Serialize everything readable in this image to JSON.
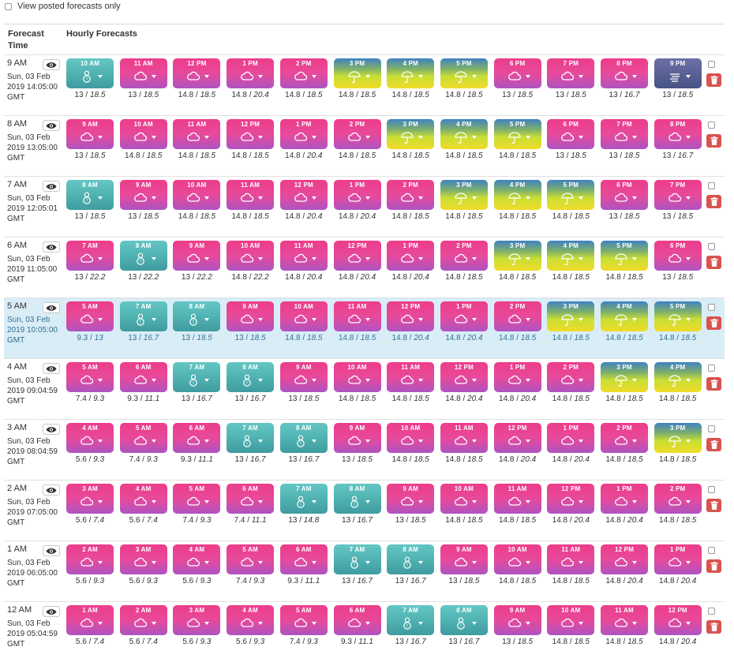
{
  "filter": {
    "label": "View posted forecasts only"
  },
  "columns": {
    "forecast_time": "Forecast\nTime",
    "hourly": "Hourly Forecasts"
  },
  "icons": {
    "rainy": "cloud-icon",
    "snow": "snowman-icon",
    "umbrella": "umbrella-icon",
    "fog": "fog-icon",
    "view": "eye-icon",
    "delete": "trash-icon"
  },
  "colors": {
    "rainy": "#e8499a",
    "snow": "#4fb0b0",
    "umbrella": "#c9de34",
    "fog": "#465384",
    "delete": "#d9534f",
    "highlight": "#d9edf7"
  },
  "rows": [
    {
      "time": "9 AM",
      "date": "Sun, 03 Feb\n2019 14:05:00\nGMT",
      "hours": [
        {
          "h": "10 AM",
          "c": "snow",
          "t": "13",
          "p": "18.5"
        },
        {
          "h": "11 AM",
          "c": "rainy",
          "t": "13",
          "p": "18.5"
        },
        {
          "h": "12 PM",
          "c": "rainy",
          "t": "14.8",
          "p": "18.5"
        },
        {
          "h": "1 PM",
          "c": "rainy",
          "t": "14.8",
          "p": "20.4"
        },
        {
          "h": "2 PM",
          "c": "rainy",
          "t": "14.8",
          "p": "18.5"
        },
        {
          "h": "3 PM",
          "c": "umbrella",
          "t": "14.8",
          "p": "18.5"
        },
        {
          "h": "4 PM",
          "c": "umbrella",
          "t": "14.8",
          "p": "18.5"
        },
        {
          "h": "5 PM",
          "c": "umbrella",
          "t": "14.8",
          "p": "18.5"
        },
        {
          "h": "6 PM",
          "c": "rainy",
          "t": "13",
          "p": "18.5"
        },
        {
          "h": "7 PM",
          "c": "rainy",
          "t": "13",
          "p": "18.5"
        },
        {
          "h": "8 PM",
          "c": "rainy",
          "t": "13",
          "p": "16.7"
        },
        {
          "h": "9 PM",
          "c": "fog",
          "t": "13",
          "p": "18.5"
        }
      ]
    },
    {
      "time": "8 AM",
      "date": "Sun, 03 Feb\n2019 13:05:00\nGMT",
      "hours": [
        {
          "h": "9 AM",
          "c": "rainy",
          "t": "13",
          "p": "18.5"
        },
        {
          "h": "10 AM",
          "c": "rainy",
          "t": "14.8",
          "p": "18.5"
        },
        {
          "h": "11 AM",
          "c": "rainy",
          "t": "14.8",
          "p": "18.5"
        },
        {
          "h": "12 PM",
          "c": "rainy",
          "t": "14.8",
          "p": "18.5"
        },
        {
          "h": "1 PM",
          "c": "rainy",
          "t": "14.8",
          "p": "20.4"
        },
        {
          "h": "2 PM",
          "c": "rainy",
          "t": "14.8",
          "p": "18.5"
        },
        {
          "h": "3 PM",
          "c": "umbrella",
          "t": "14.8",
          "p": "18.5"
        },
        {
          "h": "4 PM",
          "c": "umbrella",
          "t": "14.8",
          "p": "18.5"
        },
        {
          "h": "5 PM",
          "c": "umbrella",
          "t": "14.8",
          "p": "18.5"
        },
        {
          "h": "6 PM",
          "c": "rainy",
          "t": "13",
          "p": "18.5"
        },
        {
          "h": "7 PM",
          "c": "rainy",
          "t": "13",
          "p": "18.5"
        },
        {
          "h": "8 PM",
          "c": "rainy",
          "t": "13",
          "p": "16.7"
        }
      ]
    },
    {
      "time": "7 AM",
      "date": "Sun, 03 Feb\n2019 12:05:01\nGMT",
      "hours": [
        {
          "h": "8 AM",
          "c": "snow",
          "t": "13",
          "p": "18.5"
        },
        {
          "h": "9 AM",
          "c": "rainy",
          "t": "13",
          "p": "18.5"
        },
        {
          "h": "10 AM",
          "c": "rainy",
          "t": "14.8",
          "p": "18.5"
        },
        {
          "h": "11 AM",
          "c": "rainy",
          "t": "14.8",
          "p": "18.5"
        },
        {
          "h": "12 PM",
          "c": "rainy",
          "t": "14.8",
          "p": "20.4"
        },
        {
          "h": "1 PM",
          "c": "rainy",
          "t": "14.8",
          "p": "20.4"
        },
        {
          "h": "2 PM",
          "c": "rainy",
          "t": "14.8",
          "p": "18.5"
        },
        {
          "h": "3 PM",
          "c": "umbrella",
          "t": "14.8",
          "p": "18.5"
        },
        {
          "h": "4 PM",
          "c": "umbrella",
          "t": "14.8",
          "p": "18.5"
        },
        {
          "h": "5 PM",
          "c": "umbrella",
          "t": "14.8",
          "p": "18.5"
        },
        {
          "h": "6 PM",
          "c": "rainy",
          "t": "13",
          "p": "18.5"
        },
        {
          "h": "7 PM",
          "c": "rainy",
          "t": "13",
          "p": "18.5"
        }
      ]
    },
    {
      "time": "6 AM",
      "date": "Sun, 03 Feb\n2019 11:05:00\nGMT",
      "hours": [
        {
          "h": "7 AM",
          "c": "rainy",
          "t": "13",
          "p": "22.2"
        },
        {
          "h": "8 AM",
          "c": "snow",
          "t": "13",
          "p": "22.2"
        },
        {
          "h": "9 AM",
          "c": "rainy",
          "t": "13",
          "p": "22.2"
        },
        {
          "h": "10 AM",
          "c": "rainy",
          "t": "14.8",
          "p": "22.2"
        },
        {
          "h": "11 AM",
          "c": "rainy",
          "t": "14.8",
          "p": "20.4"
        },
        {
          "h": "12 PM",
          "c": "rainy",
          "t": "14.8",
          "p": "20.4"
        },
        {
          "h": "1 PM",
          "c": "rainy",
          "t": "14.8",
          "p": "20.4"
        },
        {
          "h": "2 PM",
          "c": "rainy",
          "t": "14.8",
          "p": "18.5"
        },
        {
          "h": "3 PM",
          "c": "umbrella",
          "t": "14.8",
          "p": "18.5"
        },
        {
          "h": "4 PM",
          "c": "umbrella",
          "t": "14.8",
          "p": "18.5"
        },
        {
          "h": "5 PM",
          "c": "umbrella",
          "t": "14.8",
          "p": "18.5"
        },
        {
          "h": "6 PM",
          "c": "rainy",
          "t": "13",
          "p": "18.5"
        }
      ]
    },
    {
      "time": "5 AM",
      "highlighted": true,
      "date": "Sun, 03 Feb\n2019 10:05:00\nGMT",
      "hours": [
        {
          "h": "5 AM",
          "c": "rainy",
          "t": "9.3",
          "p": "13"
        },
        {
          "h": "7 AM",
          "c": "snow",
          "t": "13",
          "p": "16.7"
        },
        {
          "h": "8 AM",
          "c": "snow",
          "t": "13",
          "p": "18.5"
        },
        {
          "h": "9 AM",
          "c": "rainy",
          "t": "13",
          "p": "18.5"
        },
        {
          "h": "10 AM",
          "c": "rainy",
          "t": "14.8",
          "p": "18.5"
        },
        {
          "h": "11 AM",
          "c": "rainy",
          "t": "14.8",
          "p": "18.5"
        },
        {
          "h": "12 PM",
          "c": "rainy",
          "t": "14.8",
          "p": "20.4"
        },
        {
          "h": "1 PM",
          "c": "rainy",
          "t": "14.8",
          "p": "20.4"
        },
        {
          "h": "2 PM",
          "c": "rainy",
          "t": "14.8",
          "p": "18.5"
        },
        {
          "h": "3 PM",
          "c": "umbrella",
          "t": "14.8",
          "p": "18.5"
        },
        {
          "h": "4 PM",
          "c": "umbrella",
          "t": "14.8",
          "p": "18.5"
        },
        {
          "h": "5 PM",
          "c": "umbrella",
          "t": "14.8",
          "p": "18.5"
        }
      ]
    },
    {
      "time": "4 AM",
      "date": "Sun, 03 Feb\n2019 09:04:59\nGMT",
      "hours": [
        {
          "h": "5 AM",
          "c": "rainy",
          "t": "7.4",
          "p": "9.3"
        },
        {
          "h": "6 AM",
          "c": "rainy",
          "t": "9.3",
          "p": "11.1"
        },
        {
          "h": "7 AM",
          "c": "snow",
          "t": "13",
          "p": "16.7"
        },
        {
          "h": "8 AM",
          "c": "snow",
          "t": "13",
          "p": "16.7"
        },
        {
          "h": "9 AM",
          "c": "rainy",
          "t": "13",
          "p": "18.5"
        },
        {
          "h": "10 AM",
          "c": "rainy",
          "t": "14.8",
          "p": "18.5"
        },
        {
          "h": "11 AM",
          "c": "rainy",
          "t": "14.8",
          "p": "18.5"
        },
        {
          "h": "12 PM",
          "c": "rainy",
          "t": "14.8",
          "p": "20.4"
        },
        {
          "h": "1 PM",
          "c": "rainy",
          "t": "14.8",
          "p": "20.4"
        },
        {
          "h": "2 PM",
          "c": "rainy",
          "t": "14.8",
          "p": "18.5"
        },
        {
          "h": "3 PM",
          "c": "umbrella",
          "t": "14.8",
          "p": "18.5"
        },
        {
          "h": "4 PM",
          "c": "umbrella",
          "t": "14.8",
          "p": "18.5"
        }
      ]
    },
    {
      "time": "3 AM",
      "date": "Sun, 03 Feb\n2019 08:04:59\nGMT",
      "hours": [
        {
          "h": "4 AM",
          "c": "rainy",
          "t": "5.6",
          "p": "9.3"
        },
        {
          "h": "5 AM",
          "c": "rainy",
          "t": "7.4",
          "p": "9.3"
        },
        {
          "h": "6 AM",
          "c": "rainy",
          "t": "9.3",
          "p": "11.1"
        },
        {
          "h": "7 AM",
          "c": "snow",
          "t": "13",
          "p": "16.7"
        },
        {
          "h": "8 AM",
          "c": "snow",
          "t": "13",
          "p": "16.7"
        },
        {
          "h": "9 AM",
          "c": "rainy",
          "t": "13",
          "p": "18.5"
        },
        {
          "h": "10 AM",
          "c": "rainy",
          "t": "14.8",
          "p": "18.5"
        },
        {
          "h": "11 AM",
          "c": "rainy",
          "t": "14.8",
          "p": "18.5"
        },
        {
          "h": "12 PM",
          "c": "rainy",
          "t": "14.8",
          "p": "20.4"
        },
        {
          "h": "1 PM",
          "c": "rainy",
          "t": "14.8",
          "p": "20.4"
        },
        {
          "h": "2 PM",
          "c": "rainy",
          "t": "14.8",
          "p": "18.5"
        },
        {
          "h": "3 PM",
          "c": "umbrella",
          "t": "14.8",
          "p": "18.5"
        }
      ]
    },
    {
      "time": "2 AM",
      "date": "Sun, 03 Feb\n2019 07:05:00\nGMT",
      "hours": [
        {
          "h": "3 AM",
          "c": "rainy",
          "t": "5.6",
          "p": "7.4"
        },
        {
          "h": "4 AM",
          "c": "rainy",
          "t": "5.6",
          "p": "7.4"
        },
        {
          "h": "5 AM",
          "c": "rainy",
          "t": "7.4",
          "p": "9.3"
        },
        {
          "h": "6 AM",
          "c": "rainy",
          "t": "7.4",
          "p": "11.1"
        },
        {
          "h": "7 AM",
          "c": "snow",
          "t": "13",
          "p": "14.8"
        },
        {
          "h": "8 AM",
          "c": "snow",
          "t": "13",
          "p": "16.7"
        },
        {
          "h": "9 AM",
          "c": "rainy",
          "t": "13",
          "p": "18.5"
        },
        {
          "h": "10 AM",
          "c": "rainy",
          "t": "14.8",
          "p": "18.5"
        },
        {
          "h": "11 AM",
          "c": "rainy",
          "t": "14.8",
          "p": "18.5"
        },
        {
          "h": "12 PM",
          "c": "rainy",
          "t": "14.8",
          "p": "20.4"
        },
        {
          "h": "1 PM",
          "c": "rainy",
          "t": "14.8",
          "p": "20.4"
        },
        {
          "h": "2 PM",
          "c": "rainy",
          "t": "14.8",
          "p": "18.5"
        }
      ]
    },
    {
      "time": "1 AM",
      "date": "Sun, 03 Feb\n2019 06:05:00\nGMT",
      "hours": [
        {
          "h": "2 AM",
          "c": "rainy",
          "t": "5.6",
          "p": "9.3"
        },
        {
          "h": "3 AM",
          "c": "rainy",
          "t": "5.6",
          "p": "9.3"
        },
        {
          "h": "4 AM",
          "c": "rainy",
          "t": "5.6",
          "p": "9.3"
        },
        {
          "h": "5 AM",
          "c": "rainy",
          "t": "7.4",
          "p": "9.3"
        },
        {
          "h": "6 AM",
          "c": "rainy",
          "t": "9.3",
          "p": "11.1"
        },
        {
          "h": "7 AM",
          "c": "snow",
          "t": "13",
          "p": "16.7"
        },
        {
          "h": "8 AM",
          "c": "snow",
          "t": "13",
          "p": "16.7"
        },
        {
          "h": "9 AM",
          "c": "rainy",
          "t": "13",
          "p": "18.5"
        },
        {
          "h": "10 AM",
          "c": "rainy",
          "t": "14.8",
          "p": "18.5"
        },
        {
          "h": "11 AM",
          "c": "rainy",
          "t": "14.8",
          "p": "18.5"
        },
        {
          "h": "12 PM",
          "c": "rainy",
          "t": "14.8",
          "p": "20.4"
        },
        {
          "h": "1 PM",
          "c": "rainy",
          "t": "14.8",
          "p": "20.4"
        }
      ]
    },
    {
      "time": "12 AM",
      "date": "Sun, 03 Feb\n2019 05:04:59\nGMT",
      "hours": [
        {
          "h": "1 AM",
          "c": "rainy",
          "t": "5.6",
          "p": "7.4"
        },
        {
          "h": "2 AM",
          "c": "rainy",
          "t": "5.6",
          "p": "7.4"
        },
        {
          "h": "3 AM",
          "c": "rainy",
          "t": "5.6",
          "p": "9.3"
        },
        {
          "h": "4 AM",
          "c": "rainy",
          "t": "5.6",
          "p": "9.3"
        },
        {
          "h": "5 AM",
          "c": "rainy",
          "t": "7.4",
          "p": "9.3"
        },
        {
          "h": "6 AM",
          "c": "rainy",
          "t": "9.3",
          "p": "11.1"
        },
        {
          "h": "7 AM",
          "c": "snow",
          "t": "13",
          "p": "16.7"
        },
        {
          "h": "8 AM",
          "c": "snow",
          "t": "13",
          "p": "16.7"
        },
        {
          "h": "9 AM",
          "c": "rainy",
          "t": "13",
          "p": "18.5"
        },
        {
          "h": "10 AM",
          "c": "rainy",
          "t": "14.8",
          "p": "18.5"
        },
        {
          "h": "11 AM",
          "c": "rainy",
          "t": "14.8",
          "p": "18.5"
        },
        {
          "h": "12 PM",
          "c": "rainy",
          "t": "14.8",
          "p": "20.4"
        }
      ]
    }
  ]
}
